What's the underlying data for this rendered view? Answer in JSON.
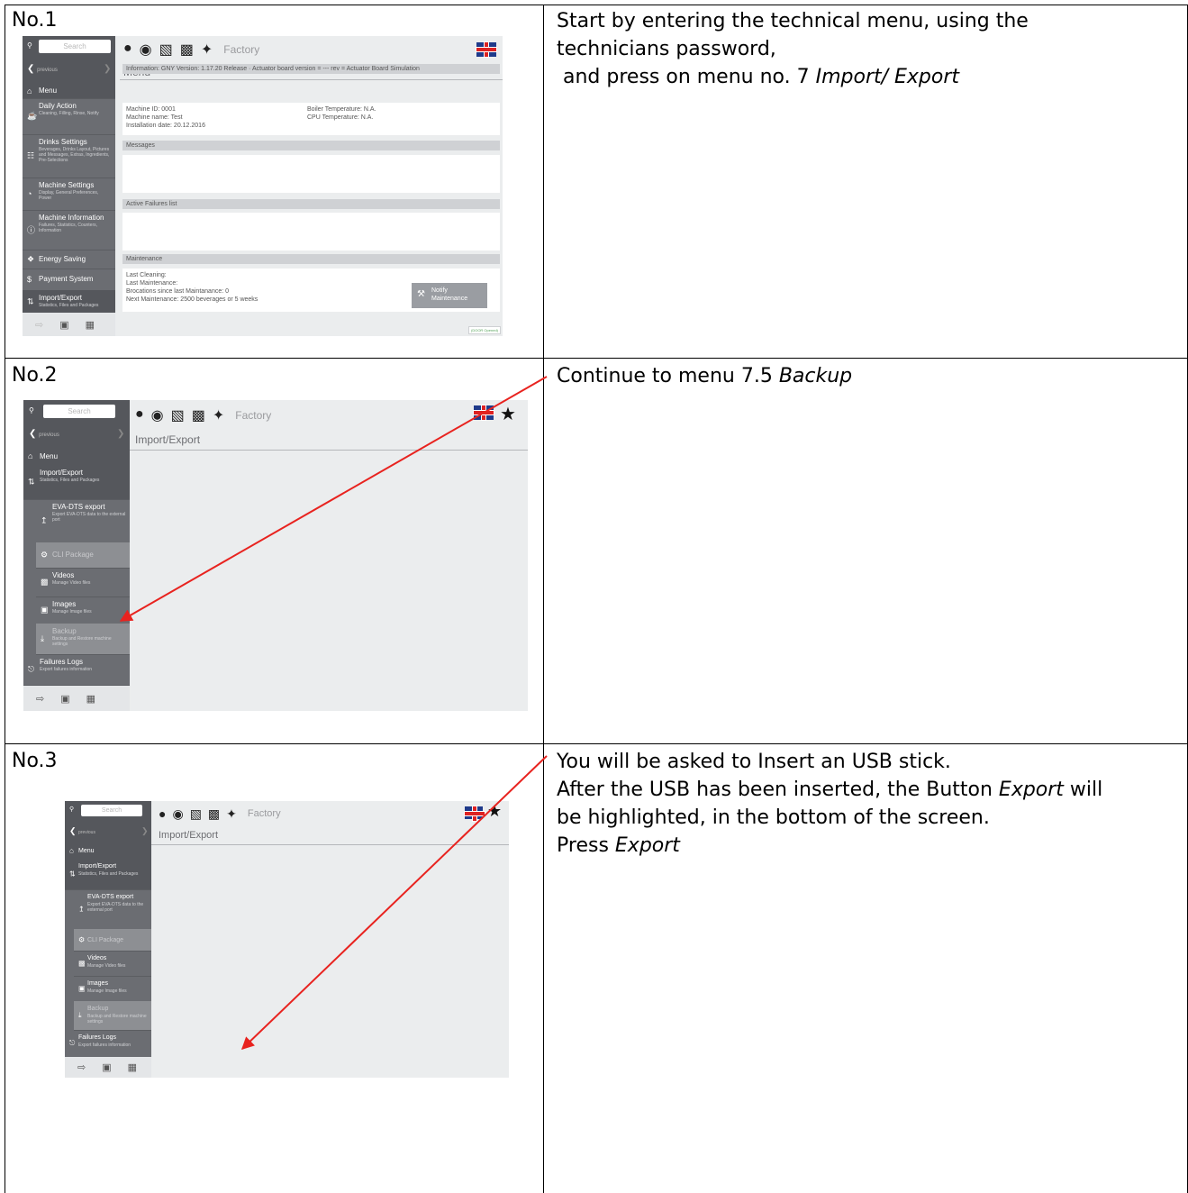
{
  "steps": [
    {
      "no": "No.1",
      "instruction": {
        "line1": "Start by entering the technical menu, using the",
        "line2": "technicians password,",
        "line3_pre": " and press on menu no. 7 ",
        "line3_em": "Import/ Export"
      },
      "screen": {
        "search_placeholder": "Search",
        "previous": "previous",
        "page_title": "Menu",
        "factory": "Factory",
        "sidebar": [
          {
            "label": "Menu",
            "sub": ""
          },
          {
            "label": "Daily Action",
            "sub": "Cleaning, Filling, Rinse, Notify"
          },
          {
            "label": "Drinks Settings",
            "sub": "Beverages, Drinks Layout, Pictures and Messages, Extras, Ingredients, Pre-Selections"
          },
          {
            "label": "Machine Settings",
            "sub": "Display, General Preferences, Power"
          },
          {
            "label": "Machine Information",
            "sub": "Failures, Statistics, Counters, Information"
          },
          {
            "label": "Energy Saving",
            "sub": ""
          },
          {
            "label": "Payment System",
            "sub": ""
          },
          {
            "label": "Import/Export",
            "sub": "Statistics, Files and Packages"
          }
        ],
        "info_header": "Information: GNY Version: 1.17.20 Release · Actuator board version = --- rev = Actuator Board Simulation",
        "info_left": [
          "Machine ID: 0001",
          "Machine name: Test",
          "Installation date: 20.12.2016"
        ],
        "info_right": [
          "Boiler Temperature: N.A.",
          "CPU Temperature: N.A."
        ],
        "messages_header": "Messages",
        "failures_header": "Active Failures list",
        "maintenance_header": "Maintenance",
        "maintenance_lines": [
          "Last Cleaning:",
          "Last Maintenance:",
          "Brocations since last Maintanance: 0",
          "Next Maintenance: 2500 beverages or 5 weeks"
        ],
        "notify_label": "Notify Maintenance",
        "status": "(DOOR Opened)"
      }
    },
    {
      "no": "No.2",
      "instruction": {
        "pre": "Continue to menu 7.5 ",
        "em": "Backup"
      },
      "screen": {
        "search_placeholder": "Search",
        "previous": "previous",
        "page_title": "Import/Export",
        "factory": "Factory",
        "sidebar": [
          {
            "label": "Menu",
            "sub": ""
          },
          {
            "label": "Import/Export",
            "sub": "Statistics, Files and Packages"
          },
          {
            "label": "EVA-DTS export",
            "sub": "Export EVA-DTS data to the external port"
          },
          {
            "label": "CLI Package",
            "sub": ""
          },
          {
            "label": "Videos",
            "sub": "Manage Video files"
          },
          {
            "label": "Images",
            "sub": "Manage Image files"
          },
          {
            "label": "Backup",
            "sub": "Backup and Restore machine settings"
          },
          {
            "label": "Failures Logs",
            "sub": "Export failures information"
          }
        ]
      }
    },
    {
      "no": "No.3",
      "instruction": {
        "line1": "You will be asked to Insert an USB stick.",
        "line2_pre": "After the USB has been inserted, the Button ",
        "line2_em": "Export",
        "line2_post": " will",
        "line3": "be highlighted, in the bottom of the screen.",
        "line4_pre": "Press ",
        "line4_em": "Export"
      },
      "screen": {
        "search_placeholder": "Search",
        "previous": "previous",
        "page_title": "Import/Export",
        "factory": "Factory",
        "sidebar": [
          {
            "label": "Menu",
            "sub": ""
          },
          {
            "label": "Import/Export",
            "sub": "Statistics, Files and Packages"
          },
          {
            "label": "EVA-DTS export",
            "sub": "Export EVA-DTS data to the external port"
          },
          {
            "label": "CLI Package",
            "sub": ""
          },
          {
            "label": "Videos",
            "sub": "Manage Video files"
          },
          {
            "label": "Images",
            "sub": "Manage Image files"
          },
          {
            "label": "Backup",
            "sub": "Backup and Restore machine settings"
          },
          {
            "label": "Failures Logs",
            "sub": "Export failures information"
          }
        ]
      }
    }
  ],
  "colors": {
    "arrow": "#e8231f",
    "sidebar": "#6b6d72",
    "content_bg": "#ebedee"
  }
}
